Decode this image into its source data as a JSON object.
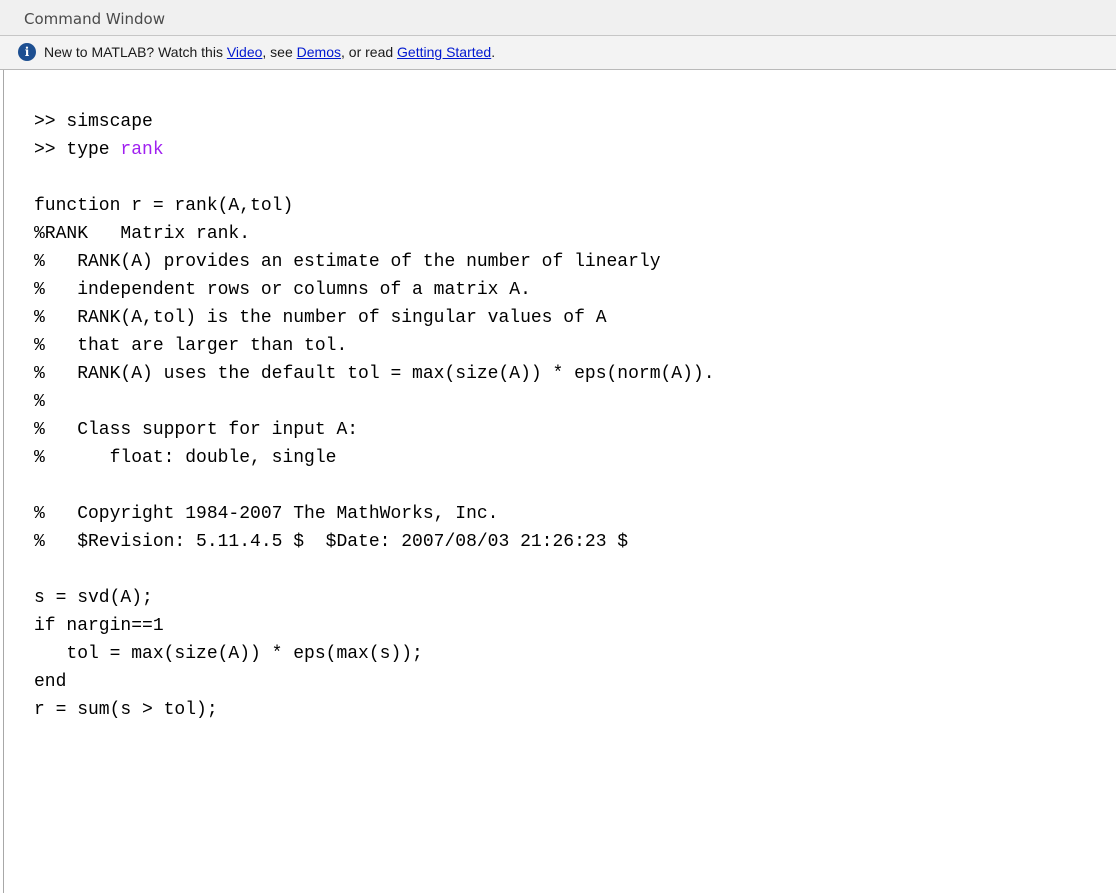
{
  "window": {
    "title": "Command Window"
  },
  "info_bar": {
    "icon": "info-icon",
    "prefix": "New to MATLAB? Watch this ",
    "video_link": "Video",
    "middle": ", see ",
    "demos_link": "Demos",
    "middle2": ", or read ",
    "getting_started_link": "Getting Started",
    "suffix": "."
  },
  "console": {
    "lines": [
      {
        "text": ">> simscape"
      },
      {
        "prompt": ">> type ",
        "arg": "rank"
      },
      {
        "text": ""
      },
      {
        "text": "function r = rank(A,tol)"
      },
      {
        "text": "%RANK   Matrix rank."
      },
      {
        "text": "%   RANK(A) provides an estimate of the number of linearly"
      },
      {
        "text": "%   independent rows or columns of a matrix A."
      },
      {
        "text": "%   RANK(A,tol) is the number of singular values of A"
      },
      {
        "text": "%   that are larger than tol."
      },
      {
        "text": "%   RANK(A) uses the default tol = max(size(A)) * eps(norm(A))."
      },
      {
        "text": "%"
      },
      {
        "text": "%   Class support for input A:"
      },
      {
        "text": "%      float: double, single"
      },
      {
        "text": ""
      },
      {
        "text": "%   Copyright 1984-2007 The MathWorks, Inc."
      },
      {
        "text": "%   $Revision: 5.11.4.5 $  $Date: 2007/08/03 21:26:23 $"
      },
      {
        "text": ""
      },
      {
        "text": "s = svd(A);"
      },
      {
        "text": "if nargin==1"
      },
      {
        "text": "   tol = max(size(A)) * eps(max(s));"
      },
      {
        "text": "end"
      },
      {
        "text": "r = sum(s > tol);"
      }
    ]
  },
  "colors": {
    "link": "#0018d0",
    "command_arg": "#a020f0",
    "info_icon": "#1d4f91"
  }
}
